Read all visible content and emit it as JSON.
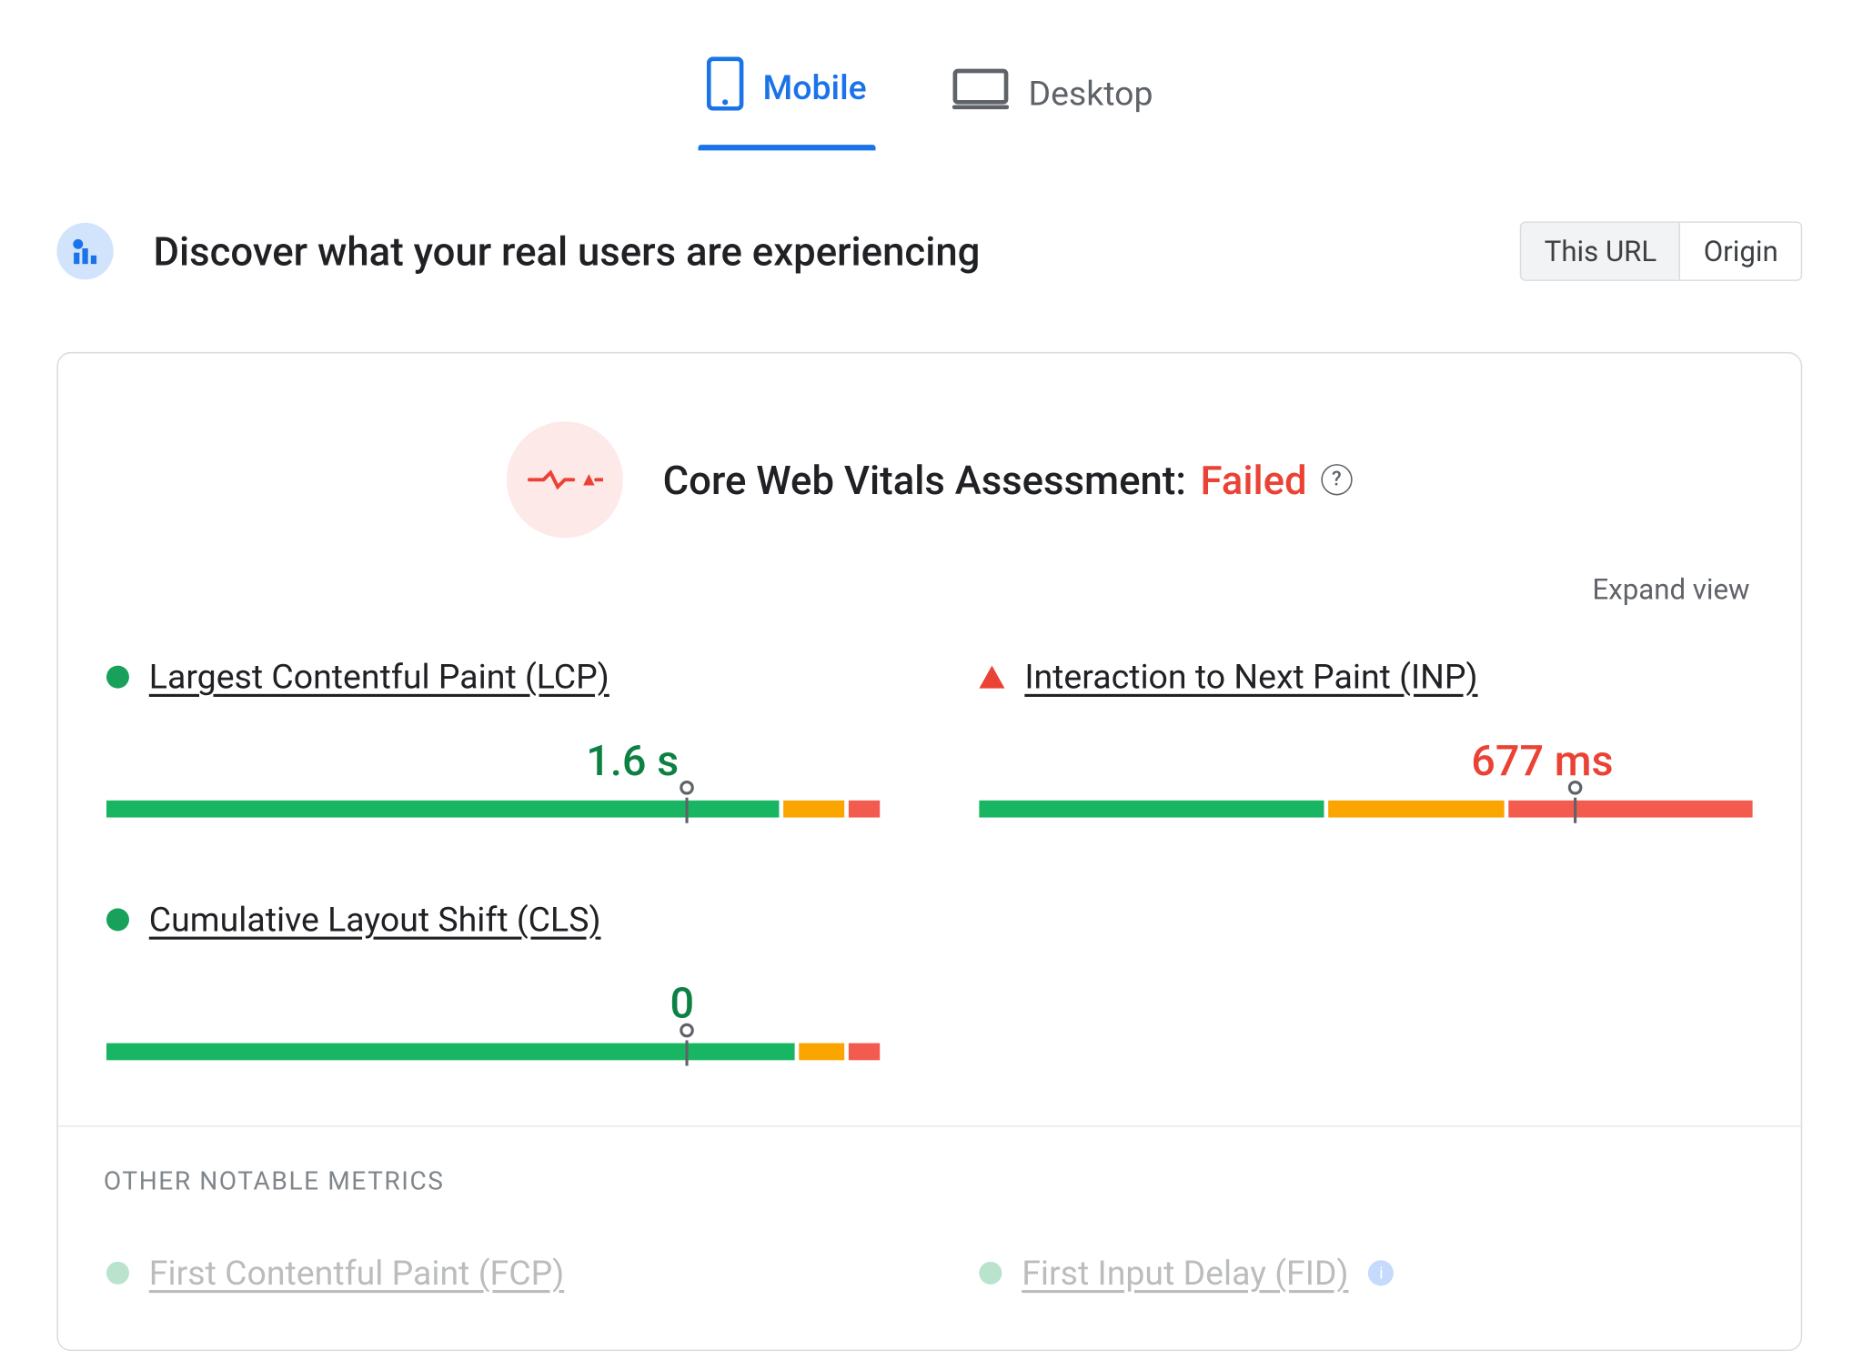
{
  "tabs": {
    "mobile": "Mobile",
    "desktop": "Desktop"
  },
  "header": {
    "title": "Discover what your real users are experiencing"
  },
  "segmented": {
    "this_url": "This URL",
    "origin": "Origin"
  },
  "assessment": {
    "label": "Core Web Vitals Assessment: ",
    "status": "Failed"
  },
  "expand_view": "Expand view",
  "metrics": {
    "lcp": {
      "name": "Largest Contentful Paint (LCP)",
      "value": "1.6 s"
    },
    "inp": {
      "name": "Interaction to Next Paint (INP)",
      "value": "677 ms"
    },
    "cls": {
      "name": "Cumulative Layout Shift (CLS)",
      "value": "0"
    }
  },
  "other_section": "OTHER NOTABLE METRICS",
  "other": {
    "fcp": {
      "name": "First Contentful Paint (FCP)"
    },
    "fid": {
      "name": "First Input Delay (FID)"
    }
  },
  "chart_data": [
    {
      "type": "bar",
      "metric": "LCP",
      "series": [
        {
          "name": "Good",
          "value": 88
        },
        {
          "name": "Needs improvement",
          "value": 8
        },
        {
          "name": "Poor",
          "value": 4
        }
      ],
      "marker_percent": 75,
      "value_label": "1.6 s",
      "status": "good"
    },
    {
      "type": "bar",
      "metric": "INP",
      "series": [
        {
          "name": "Good",
          "value": 45
        },
        {
          "name": "Needs improvement",
          "value": 23
        },
        {
          "name": "Poor",
          "value": 32
        }
      ],
      "marker_percent": 77,
      "value_label": "677 ms",
      "status": "poor"
    },
    {
      "type": "bar",
      "metric": "CLS",
      "series": [
        {
          "name": "Good",
          "value": 90
        },
        {
          "name": "Needs improvement",
          "value": 6
        },
        {
          "name": "Poor",
          "value": 4
        }
      ],
      "marker_percent": 75,
      "value_label": "0",
      "status": "good"
    }
  ]
}
